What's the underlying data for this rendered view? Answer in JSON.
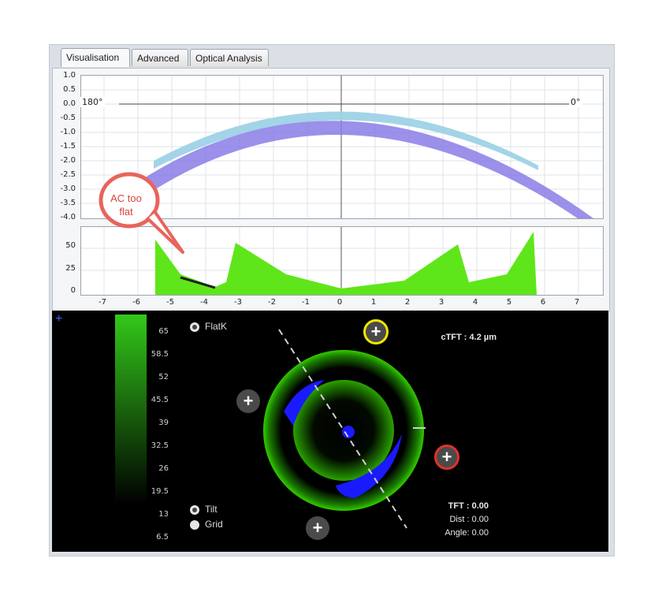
{
  "tabs": [
    {
      "label": "Visualisation",
      "active": true
    },
    {
      "label": "Advanced",
      "active": false
    },
    {
      "label": "Optical Analysis",
      "active": false
    }
  ],
  "top_plot": {
    "y_ticks": [
      "1.0",
      "0.5",
      "0.0",
      "-0.5",
      "-1.0",
      "-1.5",
      "-2.0",
      "-2.5",
      "-3.0",
      "-3.5",
      "-4.0"
    ],
    "left_meridian": "180°",
    "right_meridian": "0°"
  },
  "bottom_plot": {
    "y_ticks": [
      "50",
      "25",
      "0"
    ],
    "x_ticks": [
      "-7",
      "-6",
      "-5",
      "-4",
      "-3",
      "-2",
      "-1",
      "0",
      "1",
      "2",
      "3",
      "4",
      "5",
      "6",
      "7"
    ]
  },
  "callout": {
    "text": "AC too flat",
    "color": "#d9443c"
  },
  "map": {
    "scale_labels": [
      "65",
      "58.5",
      "52",
      "45.5",
      "39",
      "32.5",
      "26",
      "19.5",
      "13",
      "6.5"
    ],
    "flatk_label": "FlatK",
    "tilt_label": "Tilt",
    "grid_label": "Grid",
    "ctft": "cTFT : 4.2 µm",
    "tft": "TFT : 0.00",
    "dist": "Dist : 0.00",
    "angle": "Angle: 0.00",
    "accent_yellow": "#f2e600",
    "accent_red": "#e0322a",
    "ring_green": "#33cc00",
    "blue": "#1a1aff"
  }
}
